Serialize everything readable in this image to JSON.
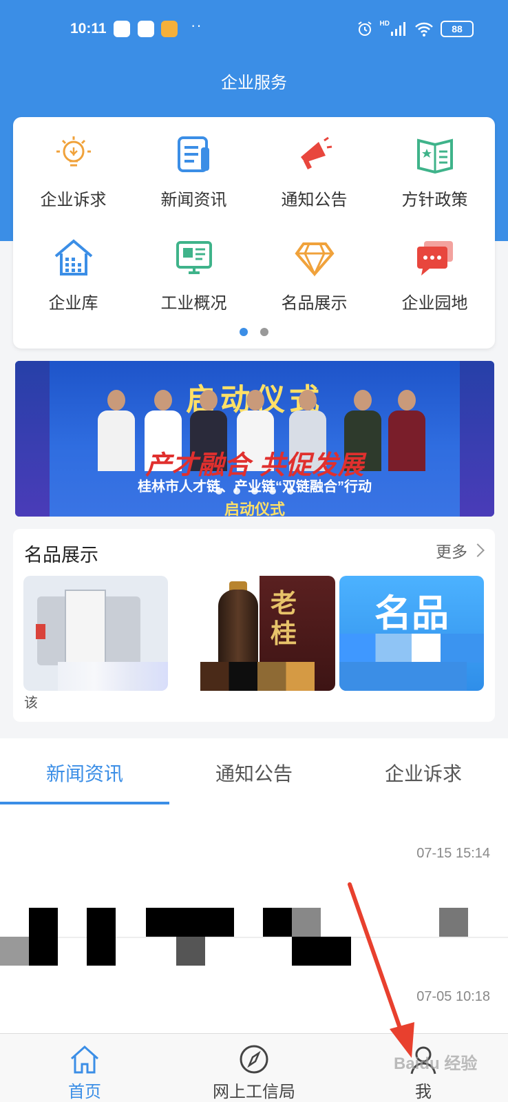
{
  "status_bar": {
    "time": "10:11",
    "notification_dots": "··",
    "network": "HD",
    "battery": "88"
  },
  "header": {
    "title": "企业服务",
    "background_color": "#3b8ee6"
  },
  "menu": {
    "items": [
      {
        "label": "企业诉求",
        "icon": "lightbulb-icon",
        "color": "#f0a23b"
      },
      {
        "label": "新闻资讯",
        "icon": "news-document-icon",
        "color": "#3b8ee6"
      },
      {
        "label": "通知公告",
        "icon": "megaphone-icon",
        "color": "#e8463d"
      },
      {
        "label": "方针政策",
        "icon": "policy-book-icon",
        "color": "#3fb38a"
      },
      {
        "label": "企业库",
        "icon": "building-icon",
        "color": "#3b8ee6"
      },
      {
        "label": "工业概况",
        "icon": "monitor-icon",
        "color": "#3fb38a"
      },
      {
        "label": "名品展示",
        "icon": "diamond-icon",
        "color": "#f0a23b"
      },
      {
        "label": "企业园地",
        "icon": "chat-bubbles-icon",
        "color": "#e8463d"
      }
    ],
    "page_count": 2,
    "active_page": 1
  },
  "banner": {
    "title": "启动仪式",
    "slogan": "产才融合 共促发展",
    "subtitle": "桂林市人才链、产业链“双链融合”行动",
    "subtitle2": "启动仪式",
    "slide_count": 5
  },
  "products": {
    "title": "名品展示",
    "more_label": "更多",
    "items": [
      {
        "name": "machinery",
        "caption": "该"
      },
      {
        "name": "liquor",
        "box_text": "老桂"
      },
      {
        "name": "promo",
        "label": "名品"
      }
    ]
  },
  "news": {
    "tabs": [
      "新闻资讯",
      "通知公告",
      "企业诉求"
    ],
    "active_tab": 0,
    "items": [
      {
        "date": "07-15 15:14"
      },
      {
        "date": "07-05 10:18"
      }
    ]
  },
  "bottom_nav": {
    "items": [
      {
        "label": "首页",
        "icon": "home-icon"
      },
      {
        "label": "网上工信局",
        "icon": "compass-icon"
      },
      {
        "label": "我",
        "icon": "user-icon"
      }
    ],
    "active": 0
  },
  "watermark": "Baidu 经验"
}
